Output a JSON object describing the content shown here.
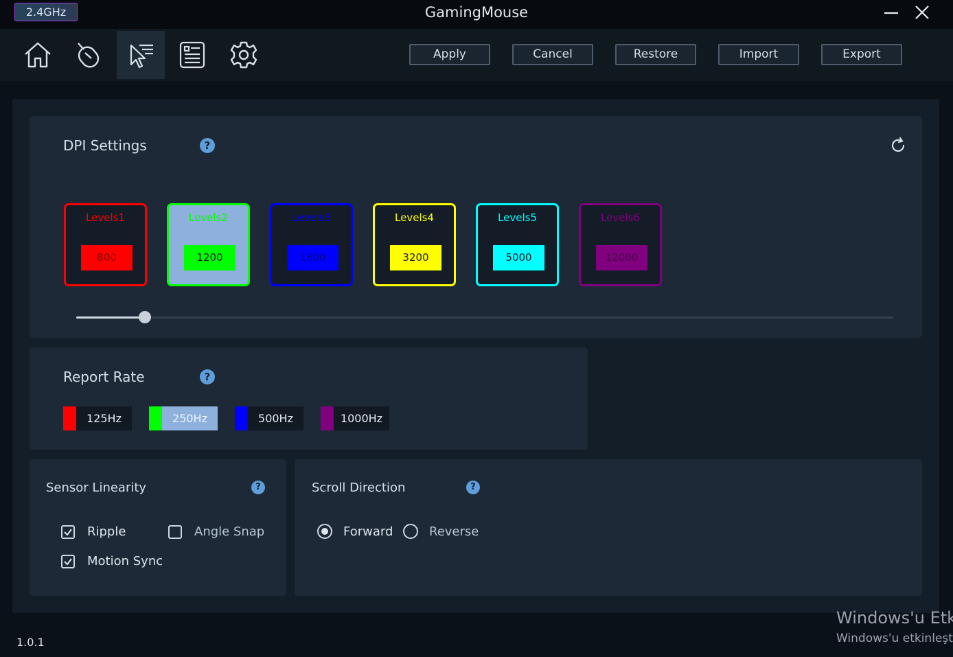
{
  "window": {
    "connection": "2.4GHz",
    "title": "GamingMouse",
    "version": "1.0.1"
  },
  "nav": {
    "items": [
      {
        "icon": "home-icon"
      },
      {
        "icon": "mouse-icon"
      },
      {
        "icon": "pointer-list-icon",
        "active": true
      },
      {
        "icon": "macro-list-icon"
      },
      {
        "icon": "gear-icon"
      }
    ]
  },
  "toolbar": {
    "apply": "Apply",
    "cancel": "Cancel",
    "restore": "Restore",
    "import": "Import",
    "export": "Export"
  },
  "dpi": {
    "title": "DPI Settings",
    "help": "?",
    "levels": [
      {
        "label": "Levels1",
        "value": "800",
        "color": "#ff0000"
      },
      {
        "label": "Levels2",
        "value": "1200",
        "color": "#00ff00",
        "selected": true
      },
      {
        "label": "Levels3",
        "value": "1600",
        "color": "#0000ff"
      },
      {
        "label": "Levels4",
        "value": "3200",
        "color": "#ffff00"
      },
      {
        "label": "Levels5",
        "value": "5000",
        "color": "#00ffff"
      },
      {
        "label": "Levels6",
        "value": "12000",
        "color": "#800080"
      }
    ],
    "slider_fraction": 0.084
  },
  "report_rate": {
    "title": "Report Rate",
    "help": "?",
    "options": [
      {
        "label": "125Hz",
        "color": "#ff0000"
      },
      {
        "label": "250Hz",
        "color": "#00ff00",
        "selected": true
      },
      {
        "label": "500Hz",
        "color": "#0000ff"
      },
      {
        "label": "1000Hz",
        "color": "#800080"
      }
    ]
  },
  "sensor": {
    "title": "Sensor Linearity",
    "help": "?",
    "ripple": {
      "label": "Ripple",
      "checked": true
    },
    "angle_snap": {
      "label": "Angle Snap",
      "checked": false
    },
    "motion_sync": {
      "label": "Motion Sync",
      "checked": true
    }
  },
  "scroll": {
    "title": "Scroll Direction",
    "help": "?",
    "forward": {
      "label": "Forward",
      "selected": true
    },
    "reverse": {
      "label": "Reverse",
      "selected": false
    }
  },
  "watermark": {
    "line1": "Windows'u Etki",
    "line2": "Windows'u etkinleştir"
  }
}
